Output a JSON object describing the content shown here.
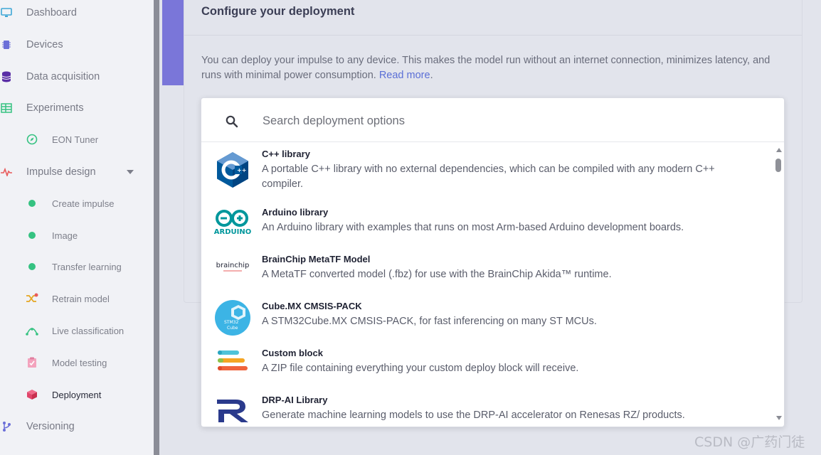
{
  "sidebar": {
    "items": [
      {
        "label": "Dashboard",
        "icon": "monitor-icon"
      },
      {
        "label": "Devices",
        "icon": "chip-icon"
      },
      {
        "label": "Data acquisition",
        "icon": "database-icon"
      },
      {
        "label": "Experiments",
        "icon": "table-icon"
      },
      {
        "label": "EON Tuner",
        "icon": "compass-icon"
      },
      {
        "label": "Impulse design",
        "icon": "pulse-icon"
      },
      {
        "label": "Create impulse",
        "icon": "green-dot-icon"
      },
      {
        "label": "Image",
        "icon": "green-dot-icon"
      },
      {
        "label": "Transfer learning",
        "icon": "green-dot-icon"
      },
      {
        "label": "Retrain model",
        "icon": "shuffle-icon"
      },
      {
        "label": "Live classification",
        "icon": "live-icon"
      },
      {
        "label": "Model testing",
        "icon": "clipboard-check-icon"
      },
      {
        "label": "Deployment",
        "icon": "cube-icon"
      },
      {
        "label": "Versioning",
        "icon": "branch-icon"
      }
    ]
  },
  "card": {
    "title": "Configure your deployment",
    "description": "You can deploy your impulse to any device. This makes the model run without an internet connection, minimizes latency, and runs with minimal power consumption.",
    "read_more": "Read more",
    "period": "."
  },
  "search": {
    "placeholder": "Search deployment options"
  },
  "options": [
    {
      "name": "C++ library",
      "description": "A portable C++ library with no external dependencies, which can be compiled with any modern C++ compiler.",
      "icon": "cpp-logo-icon"
    },
    {
      "name": "Arduino library",
      "description": "An Arduino library with examples that runs on most Arm-based Arduino development boards.",
      "icon": "arduino-logo-icon",
      "logo_text": "ARDUINO"
    },
    {
      "name": "BrainChip MetaTF Model",
      "description": "A MetaTF converted model (.fbz) for use with the BrainChip Akida™ runtime.",
      "icon": "brainchip-logo-icon",
      "logo_text": "brainchip"
    },
    {
      "name": "Cube.MX CMSIS-PACK",
      "description": "A STM32Cube.MX CMSIS-PACK, for fast inferencing on many ST MCUs.",
      "icon": "stm32cube-logo-icon"
    },
    {
      "name": "Custom block",
      "description": "A ZIP file containing everything your custom deploy block will receive.",
      "icon": "custom-block-icon"
    },
    {
      "name": "DRP-AI Library",
      "description": "Generate machine learning models to use the DRP-AI accelerator on Renesas RZ/ products.",
      "icon": "renesas-logo-icon"
    }
  ],
  "colors": {
    "accent": "#7a76d9",
    "link": "#5b6fd6",
    "green": "#35c281"
  },
  "watermark": "CSDN @广药门徒"
}
